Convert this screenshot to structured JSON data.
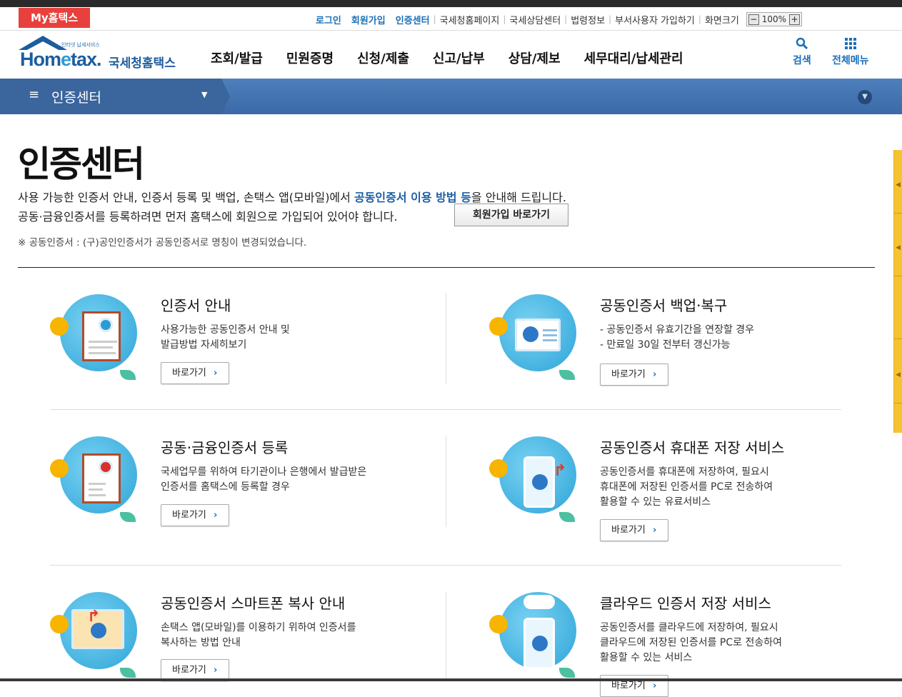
{
  "util": {
    "my_label": "My홈택스",
    "login": "로그인",
    "signup": "회원가입",
    "cert_center": "인증센터",
    "links": [
      "국세청홈페이지",
      "국세상담센터",
      "법령정보",
      "부서사용자 가입하기"
    ],
    "screen_size": "화면크기",
    "zoom_minus": "−",
    "zoom_value": "100%",
    "zoom_plus": "+"
  },
  "header": {
    "logo_small": "인터넷 납세서비스",
    "logo_hom": "Hom",
    "logo_e": "e",
    "logo_tax": "tax.",
    "logo_kr": "국세청홈택스",
    "gnb": [
      "조회/발급",
      "민원증명",
      "신청/제출",
      "신고/납부",
      "상담/제보",
      "세무대리/납세관리"
    ],
    "search_label": "검색",
    "allmenu_label": "전체메뉴"
  },
  "nav": {
    "title": "인증센터"
  },
  "page": {
    "title": "인증센터",
    "desc1_a": "사용 가능한 인증서 안내, 인증서 등록 및 백업, 손택스 앱(모바일)에서 ",
    "desc1_hl": "공동인증서 이용 방법 등",
    "desc1_b": "을 안내해 드립니다.",
    "desc2": "공동·금융인증서를 등록하려면 먼저 홈택스에 회원으로 가입되어 있어야 합니다.",
    "join_button": "회원가입 바로가기",
    "note": "※ 공동인증서 : (구)공인인증서가 공동인증서로 명칭이 변경되었습니다."
  },
  "cards": [
    {
      "title": "인증서 안내",
      "text": "사용가능한 공동인증서 안내 및\n발급방법 자세히보기",
      "button": "바로가기"
    },
    {
      "title": "공동인증서 백업·복구",
      "text": "- 공동인증서 유효기간을 연장할 경우\n- 만료일 30일 전부터 갱신가능",
      "button": "바로가기"
    },
    {
      "title": "공동·금융인증서 등록",
      "text": "국세업무를 위하여 타기관이나 은행에서 발급받은\n인증서를 홈택스에 등록할 경우",
      "button": "바로가기"
    },
    {
      "title": "공동인증서 휴대폰 저장 서비스",
      "text": "공동인증서를 휴대폰에 저장하여, 필요시\n휴대폰에 저장된 인증서를 PC로 전송하여\n활용할 수 있는 유료서비스",
      "button": "바로가기"
    },
    {
      "title": "공동인증서 스마트폰 복사 안내",
      "text": "손택스 앱(모바일)를 이용하기 위하여 인증서를\n복사하는 방법 안내",
      "button": "바로가기"
    },
    {
      "title": "클라우드 인증서 저장 서비스",
      "text": "공동인증서를 클라우드에 저장하여, 필요시\n클라우드에 저장된 인증서를 PC로 전송하여\n활용할 수 있는 서비스",
      "button": "바로가기"
    }
  ],
  "colors": {
    "accent_blue": "#1b6fb7",
    "nav_band": "#3a6aa8",
    "my_badge": "#e8403c",
    "side_tab": "#f4c430"
  }
}
